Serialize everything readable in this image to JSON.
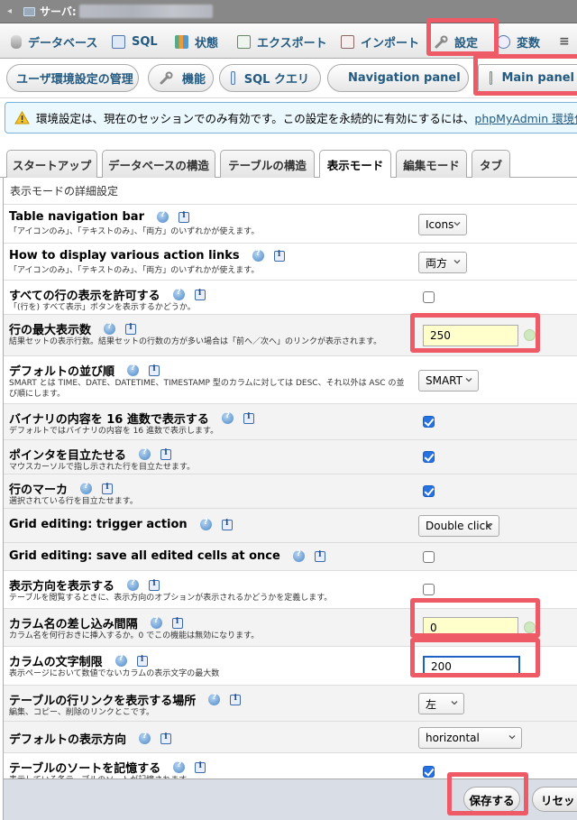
{
  "server_bar": {
    "label": "サーバ:"
  },
  "topnav": {
    "items": [
      {
        "label": "データベース",
        "icon": "database-icon"
      },
      {
        "label": "SQL",
        "icon": "sql-icon"
      },
      {
        "label": "状態",
        "icon": "status-icon"
      },
      {
        "label": "エクスポート",
        "icon": "export-icon"
      },
      {
        "label": "インポート",
        "icon": "import-icon"
      },
      {
        "label": "設定",
        "icon": "wrench-icon",
        "active": true
      },
      {
        "label": "変数",
        "icon": "variables-icon"
      }
    ]
  },
  "subnav": {
    "items": [
      {
        "label": "ユーザ環境設定の管理"
      },
      {
        "label": "機能",
        "icon": "wrench-icon"
      },
      {
        "label": "SQL クエリ",
        "icon": "sql-icon"
      },
      {
        "label": "Navigation panel",
        "icon": "navigation-icon"
      },
      {
        "label": "Main panel",
        "icon": "main-panel-icon"
      }
    ]
  },
  "notice": {
    "text": "環境設定は、現在のセッションでのみ有効です。この設定を永続的に有効にするには、",
    "link": "phpMyAdmin 環境保管領"
  },
  "config_tabs": [
    {
      "label": "スタートアップ"
    },
    {
      "label": "データベースの構造"
    },
    {
      "label": "テーブルの構造"
    },
    {
      "label": "表示モード",
      "active": true
    },
    {
      "label": "編集モード"
    },
    {
      "label": "タブ"
    }
  ],
  "form": {
    "legend": "表示モードの詳細設定",
    "rows": [
      {
        "label": "Table navigation bar",
        "desc": "「アイコンのみ」、「テキストのみ」、「両方」のいずれかが使えます。",
        "control": "select",
        "value": "Icons"
      },
      {
        "label": "How to display various action links",
        "desc": "「アイコンのみ」、「テキストのみ」、「両方」のいずれかが使えます。",
        "control": "select",
        "value": "両方"
      },
      {
        "label": "すべての行の表示を許可する",
        "desc": "「(行を) すべて表示」ボタンを表示するかどうか。",
        "control": "checkbox",
        "checked": false
      },
      {
        "label": "行の最大表示数",
        "desc": "結果セットの表示行数。結果セットの行数の方が多い場合は「前へ／次へ」のリンクが表示されます。",
        "control": "text",
        "value": "250"
      },
      {
        "label": "デフォルトの並び順",
        "desc": "SMART とは TIME、DATE、DATETIME、TIMESTAMP 型のカラムに対しては DESC、それ以外は ASC の並び順にします。",
        "control": "select",
        "value": "SMART"
      },
      {
        "label": "バイナリの内容を 16 進数で表示する",
        "desc": "デフォルトではバイナリの内容を 16 進数で表示します。",
        "control": "checkbox",
        "checked": true
      },
      {
        "label": "ポインタを目立たせる",
        "desc": "マウスカーソルで指し示された行を目立たせます。",
        "control": "checkbox",
        "checked": true
      },
      {
        "label": "行のマーカ",
        "desc": "選択されている行を目立たせます。",
        "control": "checkbox",
        "checked": true
      },
      {
        "label": "Grid editing: trigger action",
        "desc": "",
        "control": "select",
        "value": "Double click"
      },
      {
        "label": "Grid editing: save all edited cells at once",
        "desc": "",
        "control": "checkbox",
        "checked": false
      },
      {
        "label": "表示方向を表示する",
        "desc": "テーブルを閲覧するときに、表示方向のオプションが表示されるかどうかを定義します。",
        "control": "checkbox",
        "checked": false
      },
      {
        "label": "カラム名の差し込み間隔",
        "desc": "カラム名を何行おきに挿入するか。0 でこの機能は無効になります。",
        "control": "text",
        "value": "0"
      },
      {
        "label": "カラムの文字制限",
        "desc": "表示ページにおいて数値でないカラムの表示文字の最大数",
        "control": "text",
        "value": "200"
      },
      {
        "label": "テーブルの行リンクを表示する場所",
        "desc": "編集、コピー、削除のリンクとこです。",
        "control": "select",
        "value": "左"
      },
      {
        "label": "デフォルトの表示方向",
        "desc": "",
        "control": "select",
        "value": "horizontal"
      },
      {
        "label": "テーブルのソートを記憶する",
        "desc": "表示している各テーブルのソートが記憶されます。",
        "control": "checkbox",
        "checked": true
      }
    ]
  },
  "footer": {
    "save": "保存する",
    "reset": "リセット"
  },
  "colors": {
    "link": "#235a81",
    "highlight": "#ee5a66",
    "checkbox": "#2672e0",
    "notice_bg": "#ebf8fd"
  }
}
